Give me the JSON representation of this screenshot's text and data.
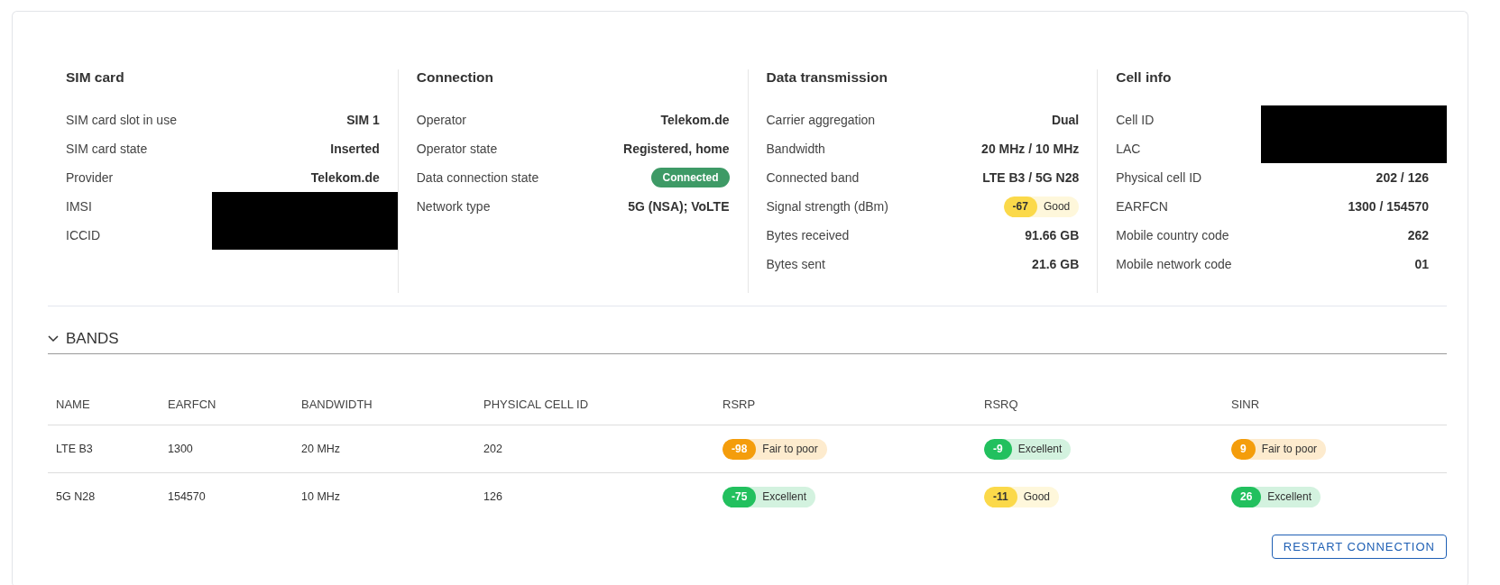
{
  "sections": [
    {
      "title": "SIM card",
      "rows": [
        {
          "label": "SIM card slot in use",
          "kind": "text",
          "value": "SIM 1"
        },
        {
          "label": "SIM card state",
          "kind": "text",
          "value": "Inserted"
        },
        {
          "label": "Provider",
          "kind": "text",
          "value": "Telekom.de"
        },
        {
          "label": "IMSI",
          "kind": "redacted"
        },
        {
          "label": "ICCID",
          "kind": "redacted"
        }
      ]
    },
    {
      "title": "Connection",
      "rows": [
        {
          "label": "Operator",
          "kind": "text",
          "value": "Telekom.de"
        },
        {
          "label": "Operator state",
          "kind": "text",
          "value": "Registered, home"
        },
        {
          "label": "Data connection state",
          "kind": "status",
          "value": "Connected"
        },
        {
          "label": "Network type",
          "kind": "text",
          "value": "5G (NSA); VoLTE"
        }
      ]
    },
    {
      "title": "Data transmission",
      "rows": [
        {
          "label": "Carrier aggregation",
          "kind": "text",
          "value": "Dual"
        },
        {
          "label": "Bandwidth",
          "kind": "text",
          "value": "20 MHz / 10 MHz"
        },
        {
          "label": "Connected band",
          "kind": "text",
          "value": "LTE B3 / 5G N28"
        },
        {
          "label": "Signal strength (dBm)",
          "kind": "signal",
          "value": "-67",
          "color": "#fbd94a",
          "quality": "Good"
        },
        {
          "label": "Bytes received",
          "kind": "text",
          "value": "91.66 GB"
        },
        {
          "label": "Bytes sent",
          "kind": "text",
          "value": "21.6 GB"
        }
      ]
    },
    {
      "title": "Cell info",
      "rows": [
        {
          "label": "Cell ID",
          "kind": "redacted"
        },
        {
          "label": "LAC",
          "kind": "redacted"
        },
        {
          "label": "Physical cell ID",
          "kind": "text",
          "value": "202 / 126"
        },
        {
          "label": "EARFCN",
          "kind": "text",
          "value": "1300 / 154570"
        },
        {
          "label": "Mobile country code",
          "kind": "text",
          "value": "262"
        },
        {
          "label": "Mobile network code",
          "kind": "text",
          "value": "01"
        }
      ]
    }
  ],
  "bands": {
    "title": "BANDS",
    "expanded": true,
    "columns": [
      "NAME",
      "EARFCN",
      "BANDWIDTH",
      "PHYSICAL CELL ID",
      "RSRP",
      "RSRQ",
      "SINR"
    ],
    "rows": [
      {
        "cells": [
          "LTE B3",
          "1300",
          "20 MHz",
          "202"
        ],
        "signals": [
          {
            "value": "-98",
            "color": "#f49d0c",
            "quality": "Fair to poor"
          },
          {
            "value": "-9",
            "color": "#22c05e",
            "quality": "Excellent"
          },
          {
            "value": "9",
            "color": "#f49d0c",
            "quality": "Fair to poor"
          }
        ]
      },
      {
        "cells": [
          "5G N28",
          "154570",
          "10 MHz",
          "126"
        ],
        "signals": [
          {
            "value": "-75",
            "color": "#22c05e",
            "quality": "Excellent"
          },
          {
            "value": "-11",
            "color": "#fbd94a",
            "quality": "Good"
          },
          {
            "value": "26",
            "color": "#22c05e",
            "quality": "Excellent"
          }
        ]
      }
    ]
  },
  "buttons": [
    "RESTART CONNECTION"
  ]
}
